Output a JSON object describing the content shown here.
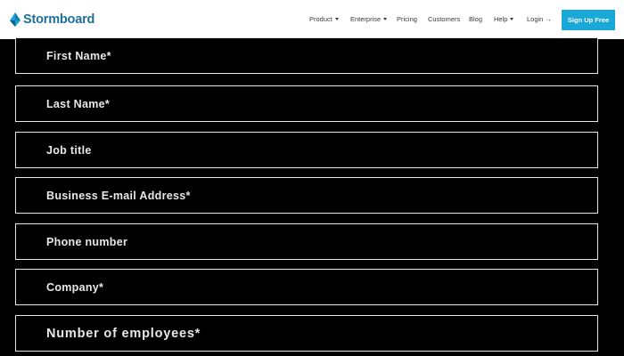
{
  "header": {
    "logo_text": "Stormboard",
    "nav": [
      {
        "label": "Product",
        "has_dropdown": true
      },
      {
        "label": "Enterprise",
        "has_dropdown": true
      },
      {
        "label": "Pricing",
        "has_dropdown": false
      },
      {
        "label": "Customers",
        "has_dropdown": false
      },
      {
        "label": "Blog",
        "has_dropdown": false
      },
      {
        "label": "Help",
        "has_dropdown": true
      },
      {
        "label": "Login",
        "has_dropdown": false
      }
    ],
    "login_arrow": "→",
    "signup_label": "Sign Up Free",
    "colors": {
      "brand": "#1f6f9a",
      "signup_bg": "#19a8d8"
    }
  },
  "form": {
    "fields": [
      {
        "label": "First Name*"
      },
      {
        "label": "Last Name*"
      },
      {
        "label": "Job title"
      },
      {
        "label": "Business E-mail Address*"
      },
      {
        "label": "Phone number"
      },
      {
        "label": "Company*"
      },
      {
        "label": "Number of employees*"
      }
    ],
    "colors": {
      "background": "#000000",
      "border": "#e6e6e6",
      "text": "#e8e8e8"
    }
  }
}
